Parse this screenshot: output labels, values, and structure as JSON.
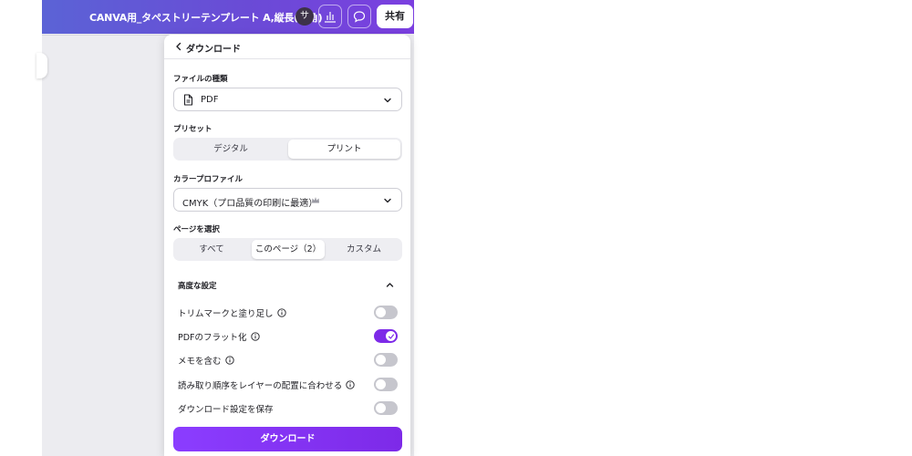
{
  "topbar": {
    "doc_title": "CANVA用_タペストリーテンプレート A,縦長(四角)",
    "avatar_initial": "サ",
    "share_label": "共有"
  },
  "panel": {
    "back_icon": "chevron-left-icon",
    "title": "ダウンロード",
    "file_type": {
      "label": "ファイルの種類",
      "value": "PDF",
      "icon": "document-icon"
    },
    "preset": {
      "label": "プリセット",
      "options": [
        "デジタル",
        "プリント"
      ],
      "selected": "プリント"
    },
    "color_profile": {
      "label": "カラープロファイル",
      "value": "CMYK（プロ品質の印刷に最適）",
      "badge_icon": "crown-icon"
    },
    "pages": {
      "label": "ページを選択",
      "options": [
        "すべて",
        "このページ（2）",
        "カスタム"
      ],
      "selected": "このページ（2）"
    },
    "advanced": {
      "title": "高度な設定",
      "expanded": true,
      "options": [
        {
          "label": "トリムマークと塗り足し",
          "info": true,
          "on": false
        },
        {
          "label": "PDFのフラット化",
          "info": true,
          "on": true
        },
        {
          "label": "メモを含む",
          "info": true,
          "on": false
        },
        {
          "label": "読み取り順序をレイヤーの配置に合わせる",
          "info": true,
          "on": false
        },
        {
          "label": "ダウンロード設定を保存",
          "info": false,
          "on": false
        }
      ]
    },
    "download_label": "ダウンロード"
  },
  "colors": {
    "accent": "#7d2ae8",
    "topbar_gradient_start": "#5b63d6",
    "topbar_gradient_end": "#7b3fe0"
  }
}
